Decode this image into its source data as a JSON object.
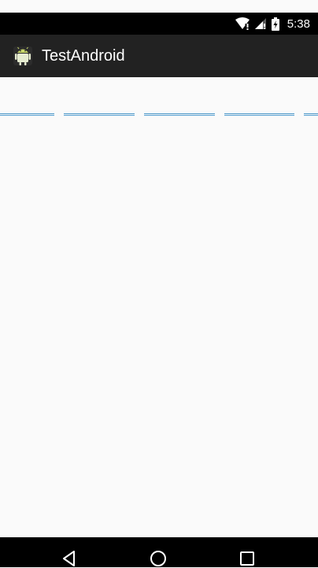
{
  "status_bar": {
    "time": "5:38",
    "icons": [
      "wifi-icon",
      "signal-icon",
      "battery-icon"
    ]
  },
  "action_bar": {
    "icon": "android-icon",
    "title": "TestAndroid",
    "background": "#222222"
  },
  "content": {
    "edit_fields": [
      {
        "value": ""
      },
      {
        "value": ""
      },
      {
        "value": ""
      },
      {
        "value": ""
      },
      {
        "value": ""
      }
    ],
    "accent": "#3e8fc4"
  },
  "nav_bar": {
    "buttons": [
      "back-icon",
      "home-icon",
      "recents-icon"
    ]
  }
}
